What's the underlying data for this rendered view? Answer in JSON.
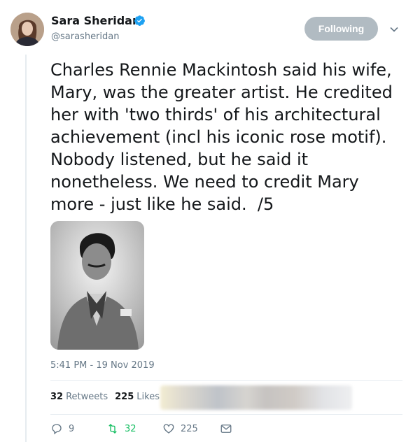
{
  "author": {
    "name": "Sara Sheridan",
    "handle": "@sarasheridan"
  },
  "follow_button_label": "Following",
  "tweet": {
    "text": "Charles Rennie Mackintosh said his wife,\nMary, was the greater artist. He credited\nher with 'two thirds' of his architectural\nachievement (incl his iconic rose motif).\nNobody listened, but he said it\nnonetheless. We need to credit Mary\nmore - just like he said.  /5",
    "timestamp": "5:41 PM - 19 Nov 2019"
  },
  "stats": {
    "retweets_count": "32",
    "retweets_label": "Retweets",
    "likes_count": "225",
    "likes_label": "Likes"
  },
  "actions": {
    "reply_count": "9",
    "retweet_count": "32",
    "like_count": "225"
  },
  "colors": {
    "verified": "#1da1f2",
    "retweet_active": "#17bf63",
    "following_button": "#b1bbc2"
  },
  "icons": [
    "verified-badge-icon",
    "chevron-down-icon",
    "reply-icon",
    "retweet-icon",
    "like-icon",
    "direct-message-icon"
  ]
}
